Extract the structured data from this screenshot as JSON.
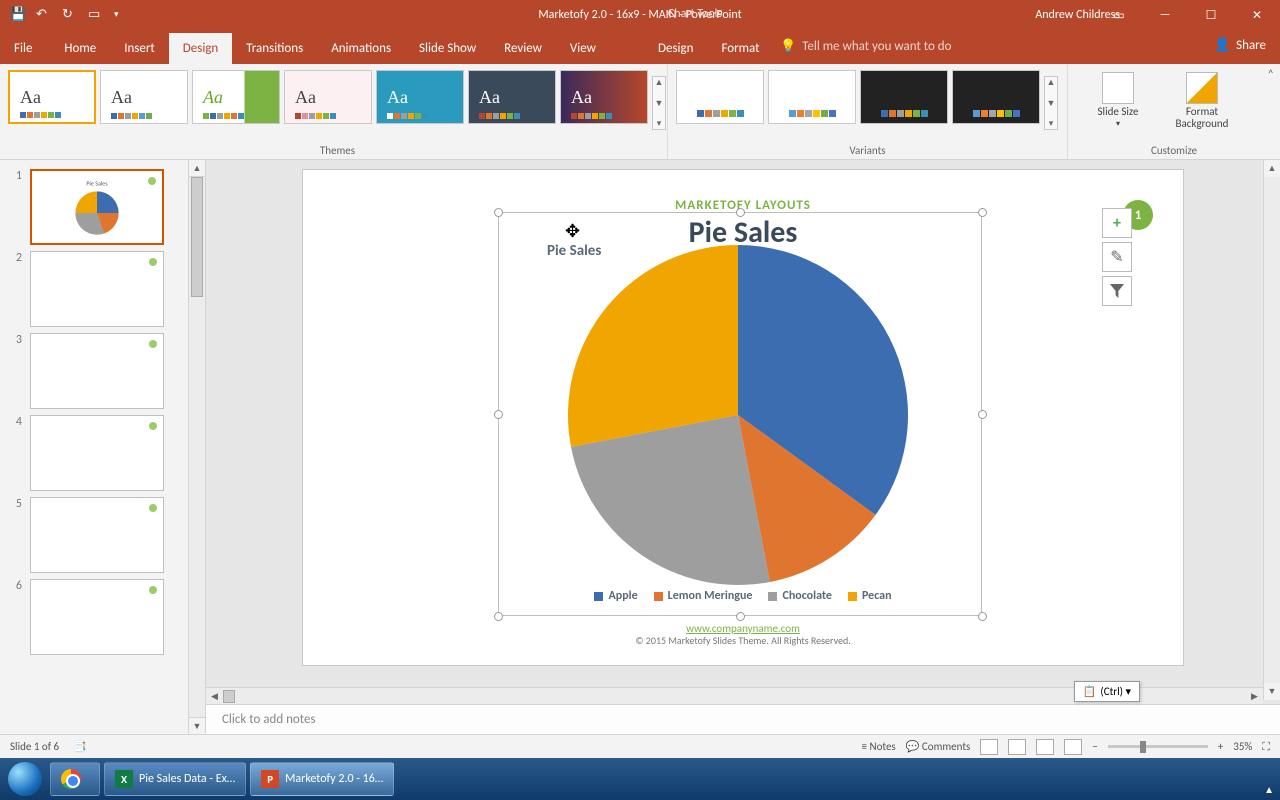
{
  "titlebar": {
    "filename": "Marketofy 2.0 - 16x9 - MAIN  -  PowerPoint",
    "context_tab": "Chart Tools",
    "user": "Andrew Childress"
  },
  "tabs": {
    "file": "File",
    "home": "Home",
    "insert": "Insert",
    "design": "Design",
    "transitions": "Transitions",
    "animations": "Animations",
    "slideshow": "Slide Show",
    "review": "Review",
    "view": "View",
    "design2": "Design",
    "format": "Format",
    "tellme": "Tell me what you want to do",
    "share": "Share"
  },
  "ribbon": {
    "themes_label": "Themes",
    "variants_label": "Variants",
    "customize_label": "Customize",
    "slide_size": "Slide Size",
    "format_bg": "Format Background"
  },
  "slide": {
    "layouts": "MARKETOFY LAYOUTS",
    "title": "Pie Sales",
    "chart_title": "Pie Sales",
    "badge": "1",
    "legend": {
      "l1": "Apple",
      "l2": "Lemon Meringue",
      "l3": "Chocolate",
      "l4": "Pecan"
    },
    "footer_url": "www.companyname.com",
    "footer_copy": "© 2015 Marketofy Slides Theme. All Rights Reserved."
  },
  "chart_data": {
    "type": "pie",
    "title": "Pie Sales",
    "categories": [
      "Apple",
      "Lemon Meringue",
      "Chocolate",
      "Pecan"
    ],
    "values": [
      35,
      12,
      25,
      28
    ],
    "colors": [
      "#3c6db0",
      "#e0752f",
      "#9e9e9e",
      "#f0a500"
    ]
  },
  "side_btns": {
    "add": "+",
    "brush": "✎",
    "filter": "▼"
  },
  "ctrl_popup": "(Ctrl) ▾",
  "notes_placeholder": "Click to add notes",
  "statusbar": {
    "slide_of": "Slide 1 of 6",
    "notes": "Notes",
    "comments": "Comments",
    "zoom": "35%"
  },
  "taskbar": {
    "excel": "Pie Sales Data - Ex…",
    "ppt": "Marketofy 2.0 - 16…"
  },
  "thumbs": [
    "1",
    "2",
    "3",
    "4",
    "5",
    "6"
  ]
}
